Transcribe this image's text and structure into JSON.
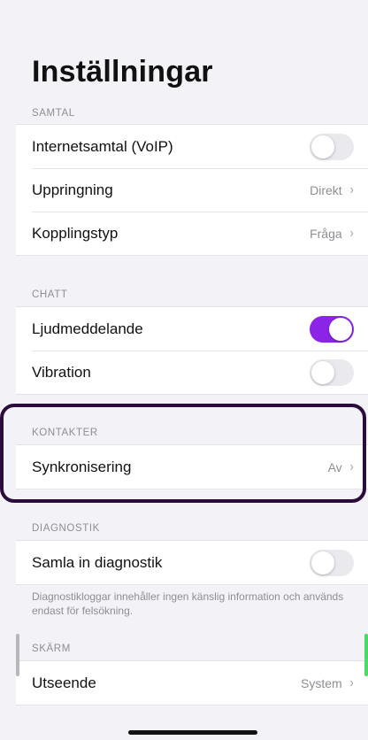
{
  "page_title": "Inställningar",
  "sections": {
    "samtal": {
      "header": "SAMTAL",
      "rows": {
        "voip": {
          "label": "Internetsamtal (VoIP)",
          "toggle": false
        },
        "uppringning": {
          "label": "Uppringning",
          "value": "Direkt"
        },
        "kopplingstyp": {
          "label": "Kopplingstyp",
          "value": "Fråga"
        }
      }
    },
    "chatt": {
      "header": "CHATT",
      "rows": {
        "ljud": {
          "label": "Ljudmeddelande",
          "toggle": true
        },
        "vibration": {
          "label": "Vibration",
          "toggle": false
        }
      }
    },
    "kontakter": {
      "header": "KONTAKTER",
      "rows": {
        "synk": {
          "label": "Synkronisering",
          "value": "Av"
        }
      }
    },
    "diagnostik": {
      "header": "DIAGNOSTIK",
      "rows": {
        "samla": {
          "label": "Samla in diagnostik",
          "toggle": false
        }
      },
      "footer": "Diagnostikloggar innehåller ingen känslig information och används endast för felsökning."
    },
    "skarm": {
      "header": "SKÄRM",
      "rows": {
        "utseende": {
          "label": "Utseende",
          "value": "System"
        }
      }
    }
  },
  "icons": {
    "chevron": "chevron-right-icon"
  },
  "colors": {
    "toggle_on": "#8b24e6",
    "highlight_border": "#2a0d3d",
    "background": "#f2f2f7"
  }
}
